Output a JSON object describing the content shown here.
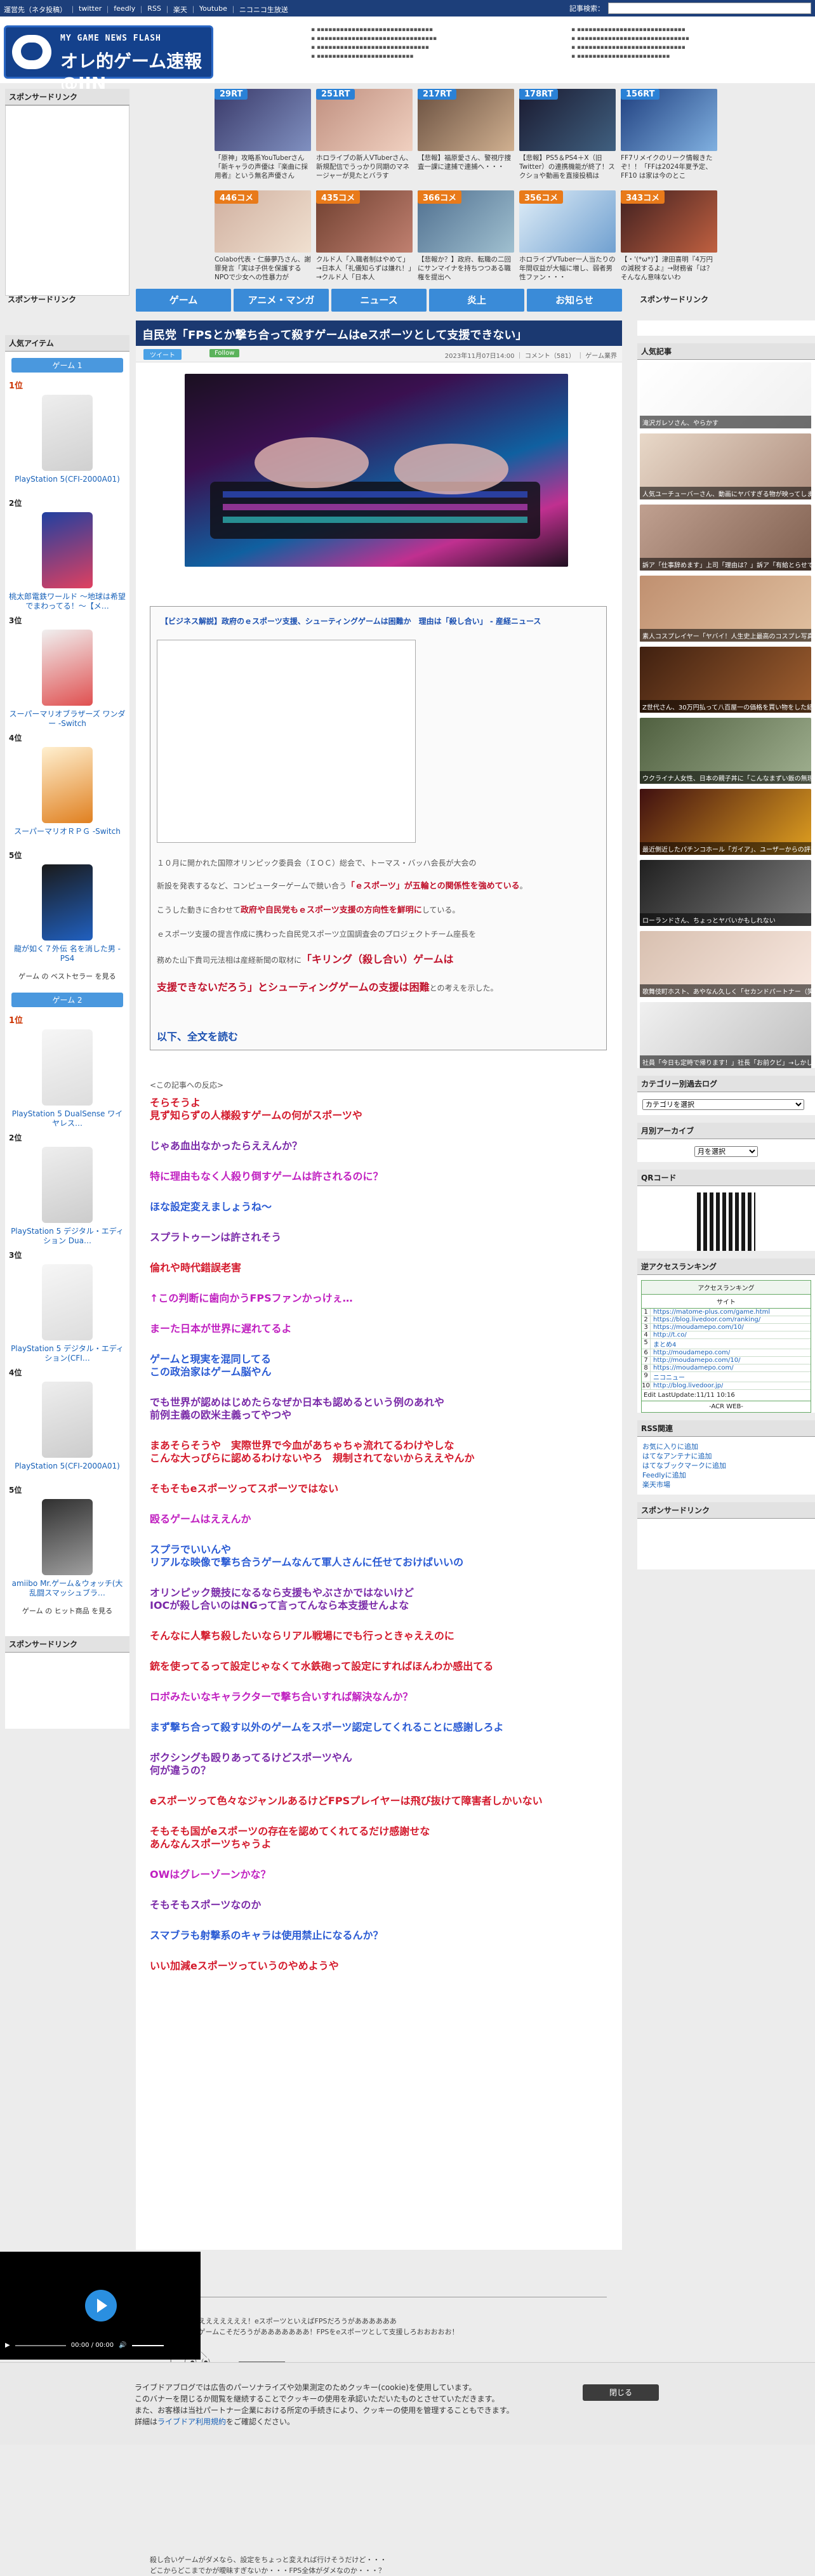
{
  "topbar": {
    "links": [
      "運営先（ネタ投稿）",
      "twitter",
      "feedly",
      "RSS",
      "楽天",
      "Youtube",
      "ニコニコ生放送"
    ],
    "search_label": "記事検索："
  },
  "logo": {
    "small": "MY GAME NEWS FLASH",
    "big": "オレ的ゲーム速報@JIN"
  },
  "sidebar_ad": "スポンサードリンク",
  "thumbs": [
    {
      "badge": "29RT",
      "caption": "「原神」攻略系YouTuberさん「新キャラの声優は『楽曲に採用者』という無名声優さん"
    },
    {
      "badge": "251RT",
      "caption": "ホロライブの新人VTuberさん、新規配信でうっかり同期のマネージャーが見たとバラす"
    },
    {
      "badge": "217RT",
      "caption": "【悲報】福原愛さん、警視庁捜査一課に逮捕で連捕へ・・・"
    },
    {
      "badge": "178RT",
      "caption": "【悲報】PS5＆PS4＋X（旧Twitter）の連携機能が終了！スクショや動画を直接投稿は"
    },
    {
      "badge": "156RT",
      "caption": "FF7リメイクのリーク情報きたぞ！！「FFは2024年夏予定、FF10 は家は今のとこ"
    },
    {
      "badge": "446コメ",
      "caption": "Colabo代表・仁藤夢乃さん、謝罪発言「実は子供を保護するNPOで少女への性暴力が"
    },
    {
      "badge": "435コメ",
      "caption": "クルド人「入職者制はやめて」→日本人「礼儀知らずは嫌れ！」→クルド人「日本人"
    },
    {
      "badge": "366コメ",
      "caption": "【悲報か？】政府、転職の二回にサンマイナを持ちつつある職権を提出へ"
    },
    {
      "badge": "356コメ",
      "caption": "ホロライブVTuber一人当たりの年間収益が大幅に増し、弱者男性ファン・・・"
    },
    {
      "badge": "343コメ",
      "caption": "【・'(*ω*)'】津田喜明『4万円の減税するよ』→財務省「は？そんなん意味ないわ"
    }
  ],
  "nav": [
    "ゲーム",
    "アニメ・マンガ",
    "ニュース",
    "炎上",
    "お知らせ"
  ],
  "left2": {
    "sponsor": "スポンサードリンク",
    "popular_items": "人気アイテム",
    "group1": {
      "label": "ゲーム 1",
      "items": [
        {
          "rank": "1位",
          "name": "PlayStation 5(CFI-2000A01)"
        },
        {
          "rank": "2位",
          "name": "桃太郎電鉄ワールド ～地球は希望でまわってる！～【メ…"
        },
        {
          "rank": "3位",
          "name": "スーパーマリオブラザーズ ワンダー -Switch"
        },
        {
          "rank": "4位",
          "name": "スーパーマリオＲＰＧ -Switch"
        },
        {
          "rank": "5位",
          "name": "龍が如く７外伝 名を消した男 - PS4"
        }
      ],
      "more": "ゲーム の ベストセラー を見る"
    },
    "group2": {
      "label": "ゲーム 2",
      "items": [
        {
          "rank": "1位",
          "name": "PlayStation 5 DualSense ワイヤレス…"
        },
        {
          "rank": "2位",
          "name": "PlayStation 5 デジタル・エディション Dua…"
        },
        {
          "rank": "3位",
          "name": "PlayStation 5 デジタル・エディション(CFI…"
        },
        {
          "rank": "4位",
          "name": "PlayStation 5(CFI-2000A01)"
        },
        {
          "rank": "5位",
          "name": "amiibo Mr.ゲーム＆ウォッチ(大乱闘スマッシュブラ…"
        }
      ],
      "more": "ゲーム の ヒット商品 を見る"
    },
    "sponsor_bottom": "スポンサードリンク"
  },
  "article": {
    "title": "自民党「FPSとか撃ち合って殺すゲームはeスポーツとして支援できない」",
    "tweet": "ツイート",
    "follow": "Follow",
    "meta": "2023年11月07日14:00 ｜ コメント（581） ｜ ゲーム業界",
    "news_title": "【ビジネス解説】政府のｅスポーツ支援、シューティングゲームは困難か　理由は「殺し合い」 - 産経ニュース",
    "p1": "１０月に開かれた国際オリンピック委員会（ＩＯＣ）総会で、トーマス・バッハ会長が大会の",
    "p2a": "新設を発表するなど、コンピューターゲームで競い合う",
    "p2b": "「ｅスポーツ」が五輪との関係性を強めている",
    "p2c": "。",
    "p3a": "こうした動きに合わせて",
    "p3b": "政府や自民党もｅスポーツ支援の方向性を鮮明に",
    "p3c": "している。",
    "p4": "ｅスポーツ支援の提言作成に携わった自民党スポーツ立国調査会のプロジェクトチーム座長を",
    "p5a": "務めた山下貴司元法相は産経新聞の取材に",
    "p5b": "「キリング（殺し合い）ゲームは",
    "p6a": "支援できないだろう」とシューティングゲームの支援は困難",
    "p6b": "との考えを示した。",
    "readmore": "以下、全文を読む"
  },
  "comments_head": "<この記事への反応>",
  "comments": [
    {
      "c": "c-red",
      "t": "そらそうよ\n見ず知らずの人様殺すゲームの何がスポーツや"
    },
    {
      "c": "c-purple",
      "t": "じゃあ血出なかったらええんか？"
    },
    {
      "c": "c-mag",
      "t": "特に理由もなく人殺り倒すゲームは許されるのに？"
    },
    {
      "c": "c-blue",
      "t": "ほな設定変えましょうね〜"
    },
    {
      "c": "c-purple",
      "t": "スプラトゥーンは許されそう"
    },
    {
      "c": "c-red",
      "t": "倫れや時代錯誤老害"
    },
    {
      "c": "c-mag",
      "t": "↑この判断に歯向かうFPSファンかっけぇ…"
    },
    {
      "c": "c-mag",
      "t": "まーた日本が世界に遅れてるよ"
    },
    {
      "c": "c-blue",
      "t": "ゲームと現実を混同してる\nこの政治家はゲーム脳やん"
    },
    {
      "c": "c-purple",
      "t": "でも世界が認めはじめたらなぜか日本も認めるという例のあれや\n前例主義の欧米主義ってやつや"
    },
    {
      "c": "c-red",
      "t": "まあそらそうや　実際世界で今血があちゃちゃ流れてるわけやしな\nこんな大っぴらに認めるわけないやろ　規制されてないからええやんか"
    },
    {
      "c": "c-red",
      "t": "そもそもeスポーツってスポーツではない"
    },
    {
      "c": "c-mag",
      "t": "殴るゲームはええんか"
    },
    {
      "c": "c-blue",
      "t": "スプラでいいんや\nリアルな映像で撃ち合うゲームなんて軍人さんに任せておけばいいの"
    },
    {
      "c": "c-purple",
      "t": "オリンピック競技になるなら支援もやぶさかではないけど\nIOCが殺し合いのはNGって言ってんなら本支援せんよな"
    },
    {
      "c": "c-red",
      "t": "そんなに人撃ち殺したいならリアル戦場にでも行っときゃええのに"
    },
    {
      "c": "c-red",
      "t": "銃を使ってるって設定じゃなくて水鉄砲って設定にすればほんわか感出てる"
    },
    {
      "c": "c-mag",
      "t": "ロボみたいなキャラクターで撃ち合いすれば解決なんか？"
    },
    {
      "c": "c-blue",
      "t": "まず撃ち合って殺す以外のゲームをスポーツ認定してくれることに感謝しろよ"
    },
    {
      "c": "c-purple",
      "t": "ボクシングも殴りあってるけどスポーツやん\n何が違うの？"
    },
    {
      "c": "c-red",
      "t": "eスポーツって色々なジャンルあるけどFPSプレイヤーは飛び抜けて障害者しかいない"
    },
    {
      "c": "c-red",
      "t": "そもそも国がeスポーツの存在を認めてくれてるだけ感謝せな\nあんなんスポーツちゃうよ"
    },
    {
      "c": "c-mag",
      "t": "OWはグレーゾーンかな？"
    },
    {
      "c": "c-purple",
      "t": "そもそもスポーツなのか"
    },
    {
      "c": "c-blue",
      "t": "スマブラも射撃系のキャラは使用禁止になるんか？"
    },
    {
      "c": "c-red",
      "t": "いい加減eスポーツっていうのやめようや"
    }
  ],
  "outro": {
    "l1": "ふざけんじゃねえええええええ！eスポーツといえばFPSだろうがああああああ",
    "l2": "撃ち合って殺すゲームこそだろうがあああああああ！FPSをeスポーツとして支援しろおおおおお！",
    "l3": "殺し合いゲームがダメなら、設定をちょっと変えれば行けそうだけど・・・",
    "l4": "どこからどこまでかが曖昧すぎないか・・・FPS全体がダメなのか・・・？"
  },
  "right": {
    "sponsor": "スポンサードリンク",
    "popular": "人気記事",
    "pops": [
      "滝沢ガレソさん、やらかす",
      "人気ユーチューバーさん、動画にヤバすぎる物が映ってしまい慌てて削除→ネットで検索されちゃう",
      "訴ア「仕事辞めます」上司「理由は？」訴ア「有給とらせてもらえない」と上司が膝から崩れ落ちてしまう→結果www",
      "素人コスプレイヤー「ヤバイ！人生史上最高のコスプレ写真撮れた！」【画像あり】→ネットで反響",
      "Z世代さん、30万円払って八百屋一の価格を買い物をした結果ｗｗｗ",
      "ウクライナ人女性、日本の親子丼に「こんなまずい飯の無理！不味すぎる」と批判",
      "最近側近したパチンコホール「ガイア」、ユーザーからの評判最悪でも業界1位になれたカラクリがヤバすぎる",
      "ローランドさん、ちょっとヤバいかもしれない",
      "歌舞伎町ホスト、あやなん久しく「セカンドパートナー（笑）」暴いたのが結局やたらの結末だった",
      "社員「今日も定時で帰ります！」社長「お前クビ」→しかし・・・"
    ],
    "category_title": "カテゴリー別過去ログ",
    "category_select": "カテゴリを選択",
    "archive_title": "月別アーカイブ",
    "archive_select": "月を選択",
    "qr_title": "QRコード",
    "ranking_title": "逆アクセスランキング",
    "ranking_head": "アクセスランキング",
    "ranking_sub": "サイト",
    "ranking_rows": [
      "https://matome-plus.com/game.html",
      "https://blog.livedoor.com/ranking/",
      "https://moudamepo.com/10/",
      "http://t.co/",
      "まとめ4",
      "http://moudamepo.com/",
      "http://moudamepo.com/10/",
      "https://moudamepo.com/",
      "ニコニュー",
      "http://blog.livedoor.jp/"
    ],
    "ranking_foot": "Edit LastUpdate:11/11 10:16",
    "ranking_brand": "-ACR WEB-",
    "rss_title": "RSS関連",
    "rss_links": [
      "お気に入りに追加",
      "はてなアンテナに追加",
      "はてなブックマークに追加",
      "Feedlyに追加",
      "楽天市場"
    ],
    "sponsor_bottom": "スポンサードリンク"
  },
  "player": {
    "time": "00:00 / 00:00"
  },
  "cookie": {
    "text1": "ライブドアブログでは広告のパーソナライズや効果測定のためクッキー(cookie)を使用しています。",
    "text2": "このバナーを閉じるか閲覧を継続することでクッキーの使用を承認いただいたものとさせていただきます。",
    "text3": "また、お客様は当社パートナー企業における所定の手続きにより、クッキーの使用を管理することもできます。",
    "text4a": "詳細は",
    "text4link": "ライブドア利用規約",
    "text4b": "をご確認ください。",
    "close": "閉じる"
  }
}
